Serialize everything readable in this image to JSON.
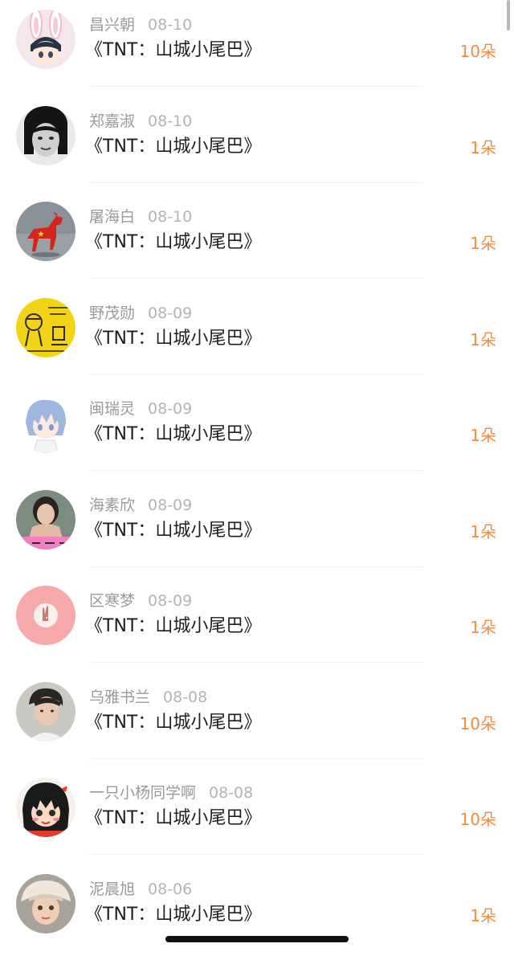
{
  "gifts": [
    {
      "name": "昌兴朝",
      "date": "08-10",
      "title": "《TNT：山城小尾巴》",
      "count": "10朵",
      "avatar": "bunny-ears-anime-avatar"
    },
    {
      "name": "郑嘉淑",
      "date": "08-10",
      "title": "《TNT：山城小尾巴》",
      "count": "1朵",
      "avatar": "black-white-portrait-avatar"
    },
    {
      "name": "屠海白",
      "date": "08-10",
      "title": "《TNT：山城小尾巴》",
      "count": "1朵",
      "avatar": "red-horse-figurine-avatar"
    },
    {
      "name": "野茂勋",
      "date": "08-09",
      "title": "《TNT：山城小尾巴》",
      "count": "1朵",
      "avatar": "yellow-doodle-avatar"
    },
    {
      "name": "闽瑞灵",
      "date": "08-09",
      "title": "《TNT：山城小尾巴》",
      "count": "1朵",
      "avatar": "blue-hair-anime-avatar"
    },
    {
      "name": "海素欣",
      "date": "08-09",
      "title": "《TNT：山城小尾巴》",
      "count": "1朵",
      "avatar": "woman-photo-avatar"
    },
    {
      "name": "区寒梦",
      "date": "08-09",
      "title": "《TNT：山城小尾巴》",
      "count": "1朵",
      "avatar": "pink-rabbit-avatar"
    },
    {
      "name": "乌雅书兰",
      "date": "08-08",
      "title": "《TNT：山城小尾巴》",
      "count": "10朵",
      "avatar": "young-man-photo-avatar"
    },
    {
      "name": "一只小杨同学啊",
      "date": "08-08",
      "title": "《TNT：山城小尾巴》",
      "count": "10朵",
      "avatar": "cartoon-girl-avatar"
    },
    {
      "name": "泥晨旭",
      "date": "08-06",
      "title": "《TNT：山城小尾巴》",
      "count": "1朵",
      "avatar": "child-hat-photo-avatar"
    }
  ],
  "colors": {
    "count_accent": "#f58c3c",
    "name_text": "#9a9a9a",
    "title_text": "#1e1e1e"
  }
}
